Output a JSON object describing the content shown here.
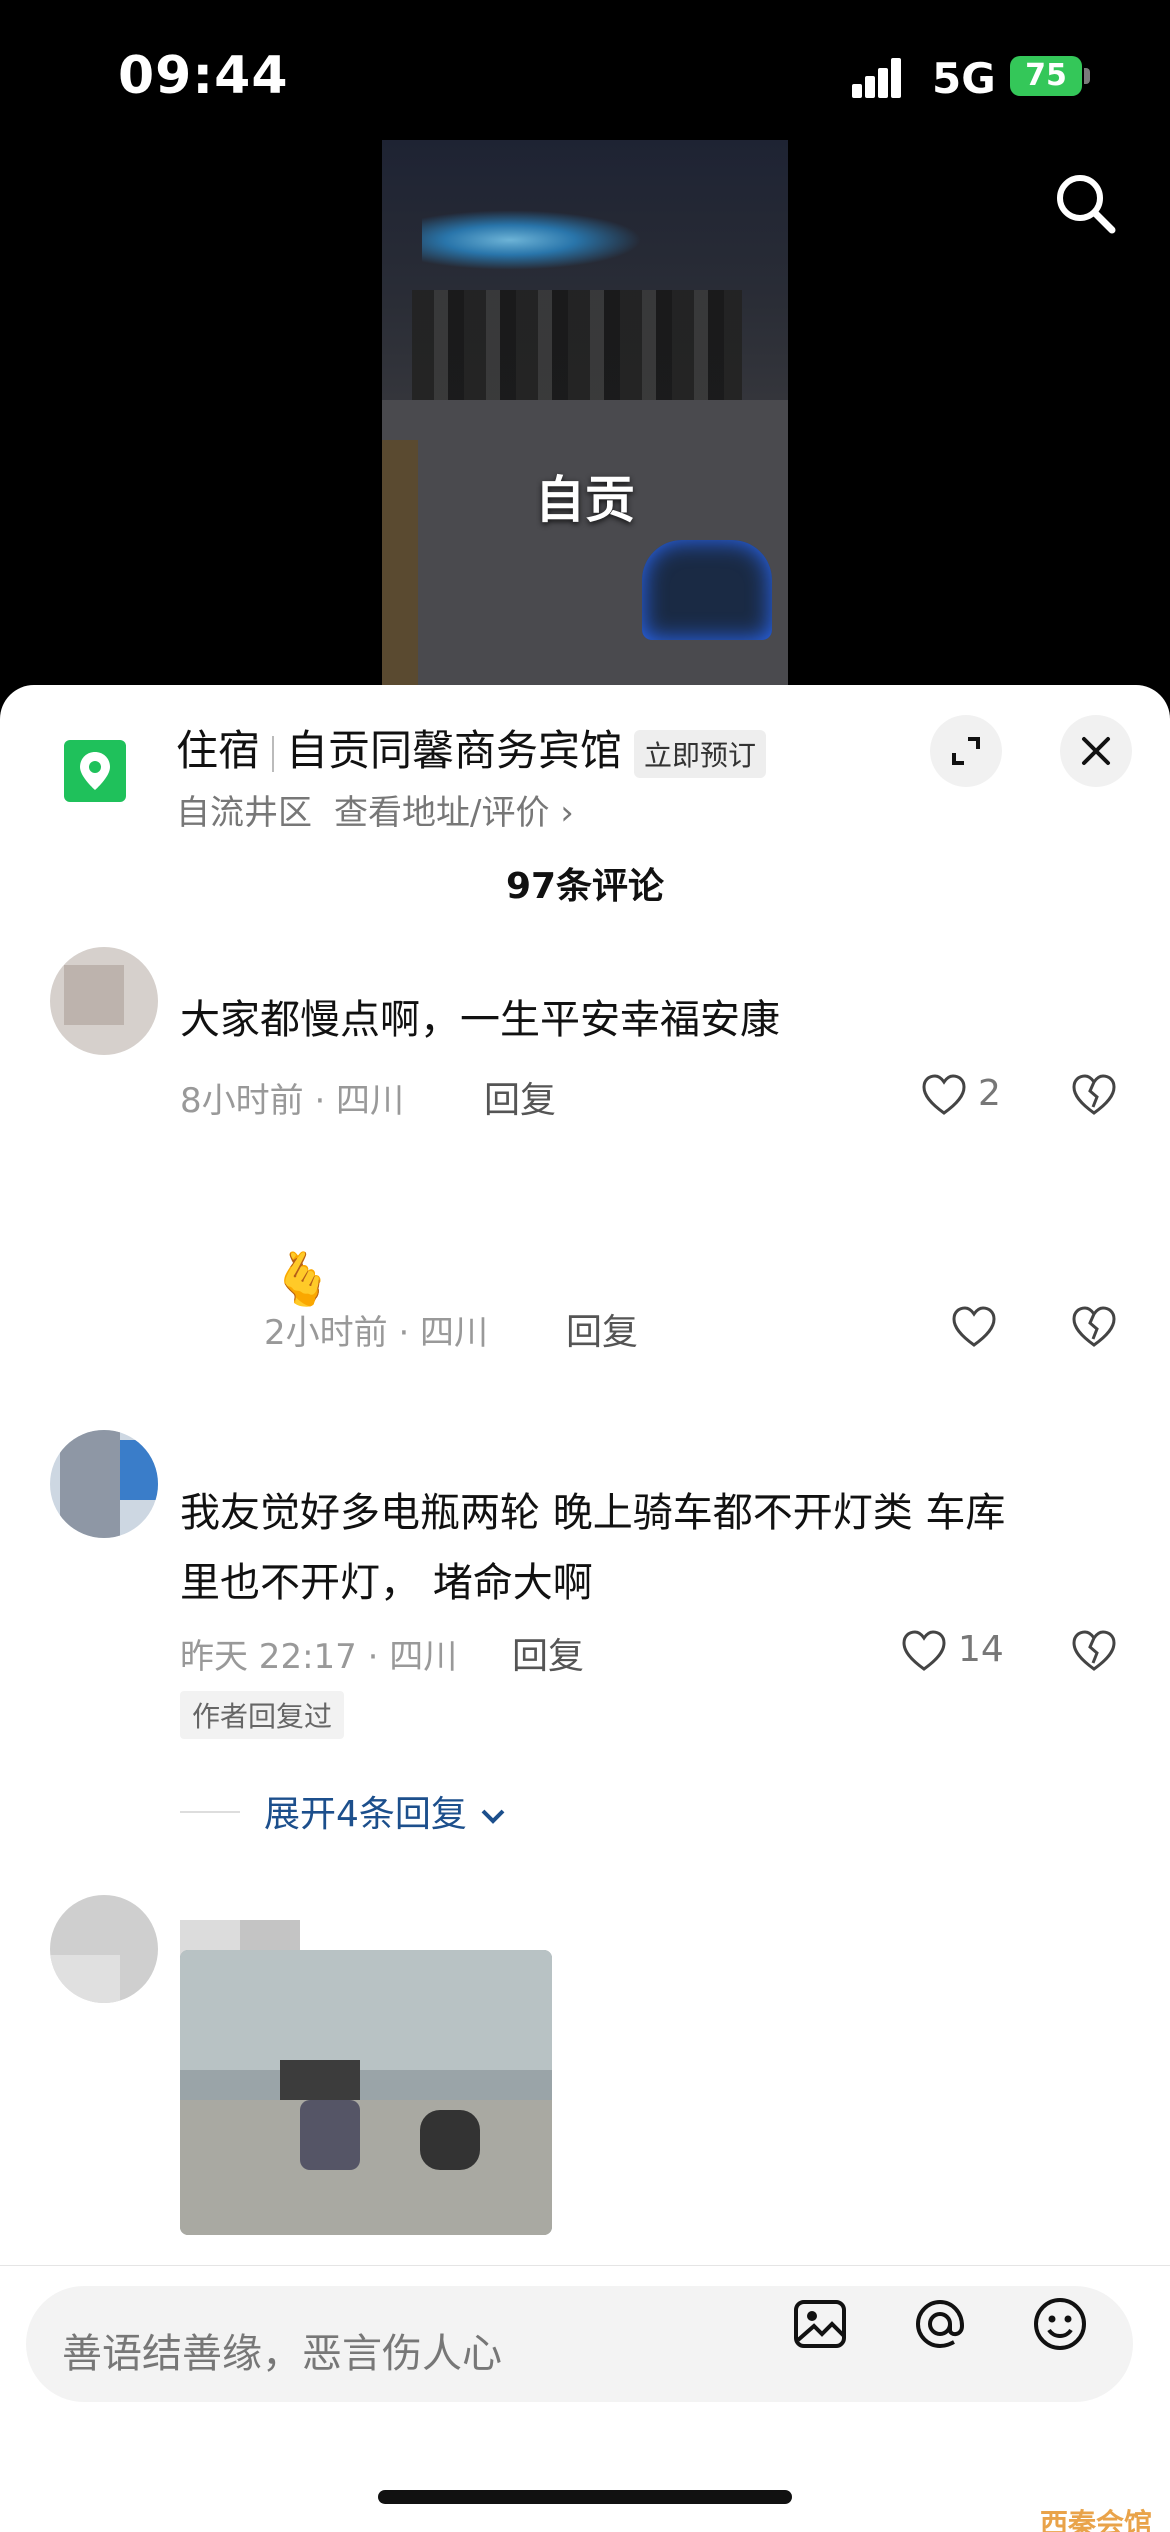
{
  "status_bar": {
    "time": "09:44",
    "network": "5G",
    "battery": "75"
  },
  "video": {
    "caption": "自贡"
  },
  "poi": {
    "category": "住宿",
    "name": "自贡同馨商务宾馆",
    "book_badge": "立即预订",
    "district": "自流井区",
    "address_link": "查看地址/评价 ›"
  },
  "comments_header": {
    "count_label": "97条评论"
  },
  "comments": [
    {
      "text": "大家都慢点啊，一生平安幸福安康",
      "meta": "8小时前 · 四川",
      "reply": "回复",
      "likes": "2"
    },
    {
      "text": "🫰",
      "meta": "2小时前 · 四川",
      "reply": "回复",
      "likes": ""
    },
    {
      "text_lines": [
        "我友觉好多电瓶两轮 晚上骑车都不开灯类  车库",
        "里也不开灯，    堵命大啊"
      ],
      "meta": "昨天 22:17 · 四川",
      "reply": "回复",
      "likes": "14",
      "author_tag": "作者回复过",
      "expand": "展开4条回复"
    }
  ],
  "input": {
    "placeholder": "善语结善缘，恶言伤人心"
  },
  "watermark": "西秦会馆",
  "colors": {
    "accent_blue": "#1c4f8c",
    "poi_green": "#1fc15b",
    "battery_green": "#34c759"
  }
}
